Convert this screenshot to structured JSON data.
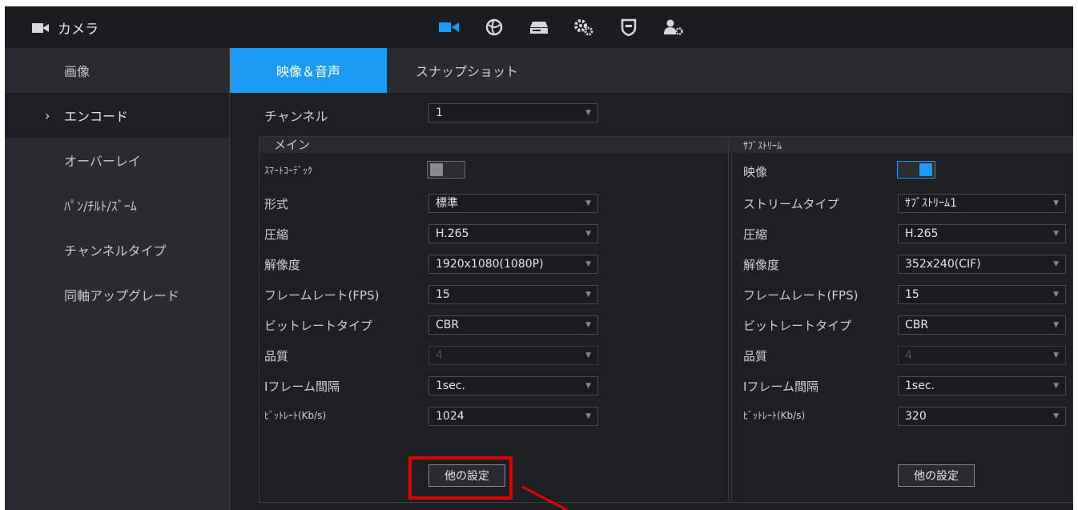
{
  "app": {
    "title": "カメラ"
  },
  "top_icons": [
    "camera-icon",
    "network-icon",
    "storage-icon",
    "system-settings-icon",
    "security-icon",
    "account-icon"
  ],
  "colors": {
    "accent": "#1b9cf2",
    "highlight": "#e30000"
  },
  "sidebar": {
    "items": [
      {
        "label": "画像"
      },
      {
        "label": "エンコード",
        "marker": "›",
        "active": true
      },
      {
        "label": "オーバーレイ"
      },
      {
        "label": "ﾊﾟﾝ/ﾁﾙﾄ/ｽﾞｰﾑ"
      },
      {
        "label": "チャンネルタイプ"
      },
      {
        "label": "同軸アップグレード"
      }
    ]
  },
  "tabs": [
    {
      "label": "映像＆音声",
      "active": true
    },
    {
      "label": "スナップショット"
    }
  ],
  "channel": {
    "label": "チャンネル",
    "value": "1"
  },
  "main": {
    "title": "メイン",
    "smart_codec_label": "ｽﾏｰﾄｺｰﾃﾞｯｸ",
    "smart_codec_on": false,
    "fields": [
      {
        "label": "形式",
        "value": "標準"
      },
      {
        "label": "圧縮",
        "value": "H.265"
      },
      {
        "label": "解像度",
        "value": "1920x1080(1080P)"
      },
      {
        "label": "フレームレート(FPS)",
        "value": "15"
      },
      {
        "label": "ビットレートタイプ",
        "value": "CBR"
      },
      {
        "label": "品質",
        "value": "4",
        "disabled": true
      },
      {
        "label": "Iフレーム間隔",
        "value": "1sec."
      },
      {
        "label": "ﾋﾞｯﾄﾚｰﾄ(Kb/s)",
        "value": "1024"
      }
    ],
    "other_settings_button": "他の設定"
  },
  "sub": {
    "title": "ｻﾌﾞｽﾄﾘｰﾑ",
    "video_label": "映像",
    "video_on": true,
    "fields": [
      {
        "label": "ストリームタイプ",
        "value": "ｻﾌﾞｽﾄﾘｰﾑ1"
      },
      {
        "label": "圧縮",
        "value": "H.265"
      },
      {
        "label": "解像度",
        "value": "352x240(CIF)"
      },
      {
        "label": "フレームレート(FPS)",
        "value": "15"
      },
      {
        "label": "ビットレートタイプ",
        "value": "CBR"
      },
      {
        "label": "品質",
        "value": "4",
        "disabled": true
      },
      {
        "label": "Iフレーム間隔",
        "value": "1sec."
      },
      {
        "label": "ﾋﾞｯﾄﾚｰﾄ(Kb/s)",
        "value": "320"
      }
    ],
    "other_settings_button": "他の設定"
  }
}
